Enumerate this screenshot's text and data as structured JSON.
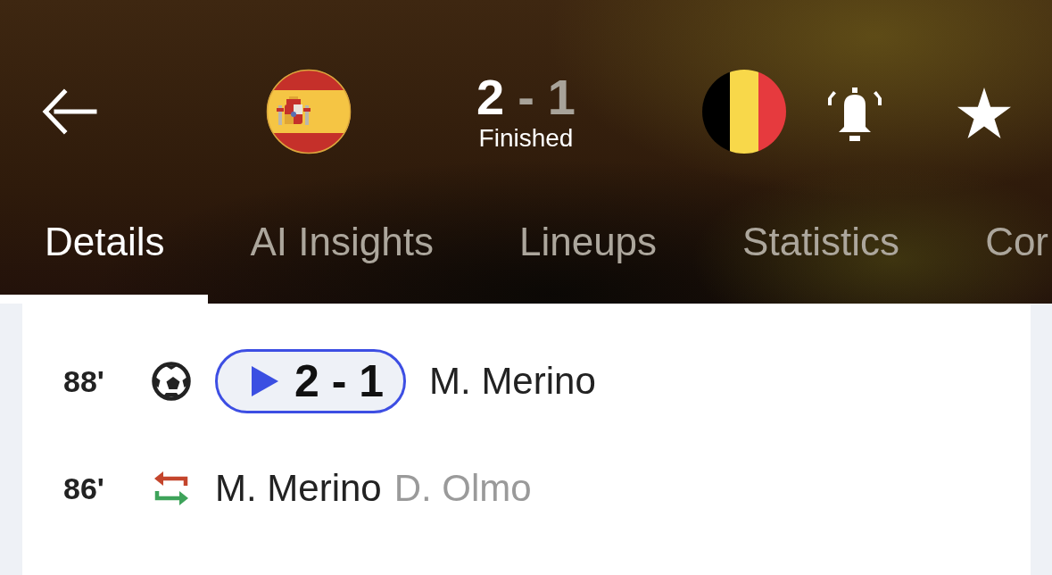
{
  "match": {
    "home_score": {
      "text": "2",
      "highlighted": true
    },
    "separator": "-",
    "away_score": {
      "text": "1",
      "highlighted": false
    },
    "status": "Finished"
  },
  "tabs": [
    {
      "label": "Details",
      "selected": true
    },
    {
      "label": "AI Insights",
      "selected": false
    },
    {
      "label": "Lineups",
      "selected": false
    },
    {
      "label": "Statistics",
      "selected": false
    },
    {
      "label": "Cor",
      "selected": false
    }
  ],
  "events": [
    {
      "kind": "goal",
      "minute": "88'",
      "score": "2 - 1",
      "player": "M. Merino"
    },
    {
      "kind": "substitution",
      "minute": "86'",
      "player_in": "M. Merino",
      "player_out": "D. Olmo"
    }
  ]
}
